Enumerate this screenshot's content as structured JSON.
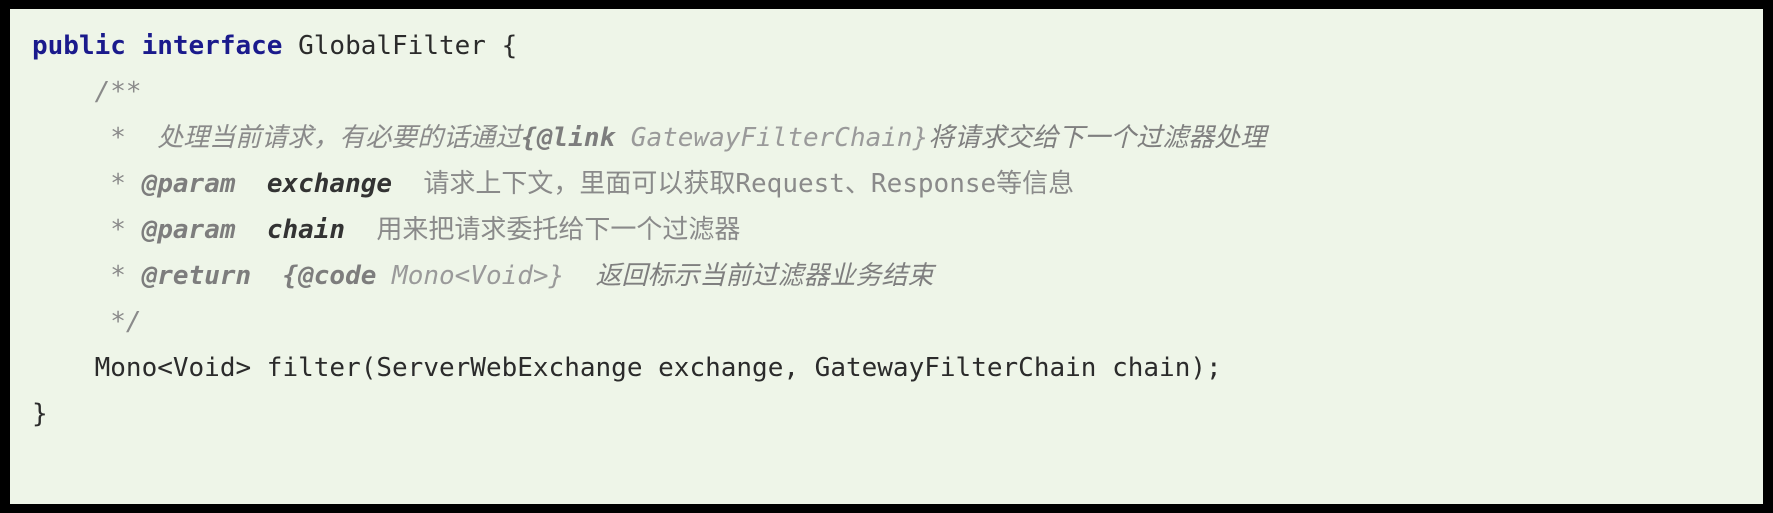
{
  "editor": {
    "language": "java",
    "background_color": "#eef5e8",
    "border_color": "#000000",
    "keyword_color": "#1a1a8c",
    "comment_color": "#8a8a8a",
    "text_color": "#2b2b2b"
  },
  "code": {
    "lines": [
      {
        "id": "line-1-interface-decl",
        "tokens": [
          {
            "cls": "kw",
            "text": "public interface"
          },
          {
            "cls": "plain",
            "text": " GlobalFilter {"
          }
        ]
      },
      {
        "id": "line-2-javadoc-open",
        "tokens": [
          {
            "cls": "cmt",
            "text": "    /**"
          }
        ]
      },
      {
        "id": "line-3-javadoc-desc",
        "tokens": [
          {
            "cls": "cmt",
            "text": "     *  处理当前请求，有必要的话通过"
          },
          {
            "cls": "cmt-tag",
            "text": "{@link"
          },
          {
            "cls": "cmt-code",
            "text": " GatewayFilterChain}"
          },
          {
            "cls": "cmt-cjk",
            "text": "将请求交给下一个过滤器处理"
          }
        ]
      },
      {
        "id": "line-4-param-exchange",
        "tokens": [
          {
            "cls": "cmt",
            "text": "     * "
          },
          {
            "cls": "cmt-tag",
            "text": "@param"
          },
          {
            "cls": "cmt",
            "text": "  "
          },
          {
            "cls": "cmt-param",
            "text": "exchange"
          },
          {
            "cls": "cmt-cjk-up",
            "text": "  请求上下文，里面可以获取Request、Response等信息"
          }
        ]
      },
      {
        "id": "line-5-param-chain",
        "tokens": [
          {
            "cls": "cmt",
            "text": "     * "
          },
          {
            "cls": "cmt-tag",
            "text": "@param"
          },
          {
            "cls": "cmt",
            "text": "  "
          },
          {
            "cls": "cmt-param",
            "text": "chain"
          },
          {
            "cls": "cmt-cjk-up",
            "text": "  用来把请求委托给下一个过滤器"
          }
        ]
      },
      {
        "id": "line-6-return",
        "tokens": [
          {
            "cls": "cmt",
            "text": "     * "
          },
          {
            "cls": "cmt-tag",
            "text": "@return"
          },
          {
            "cls": "cmt",
            "text": "  "
          },
          {
            "cls": "cmt-tag",
            "text": "{@code"
          },
          {
            "cls": "cmt-code",
            "text": " Mono<Void>}"
          },
          {
            "cls": "cmt-cjk",
            "text": "  返回标示当前过滤器业务结束"
          }
        ]
      },
      {
        "id": "line-7-javadoc-close",
        "tokens": [
          {
            "cls": "cmt",
            "text": "     */"
          }
        ]
      },
      {
        "id": "line-8-method-signature",
        "tokens": [
          {
            "cls": "plain",
            "text": "    Mono<Void> filter(ServerWebExchange exchange, GatewayFilterChain chain);"
          }
        ]
      },
      {
        "id": "line-9-close-brace",
        "tokens": [
          {
            "cls": "plain",
            "text": "}"
          }
        ]
      }
    ]
  }
}
